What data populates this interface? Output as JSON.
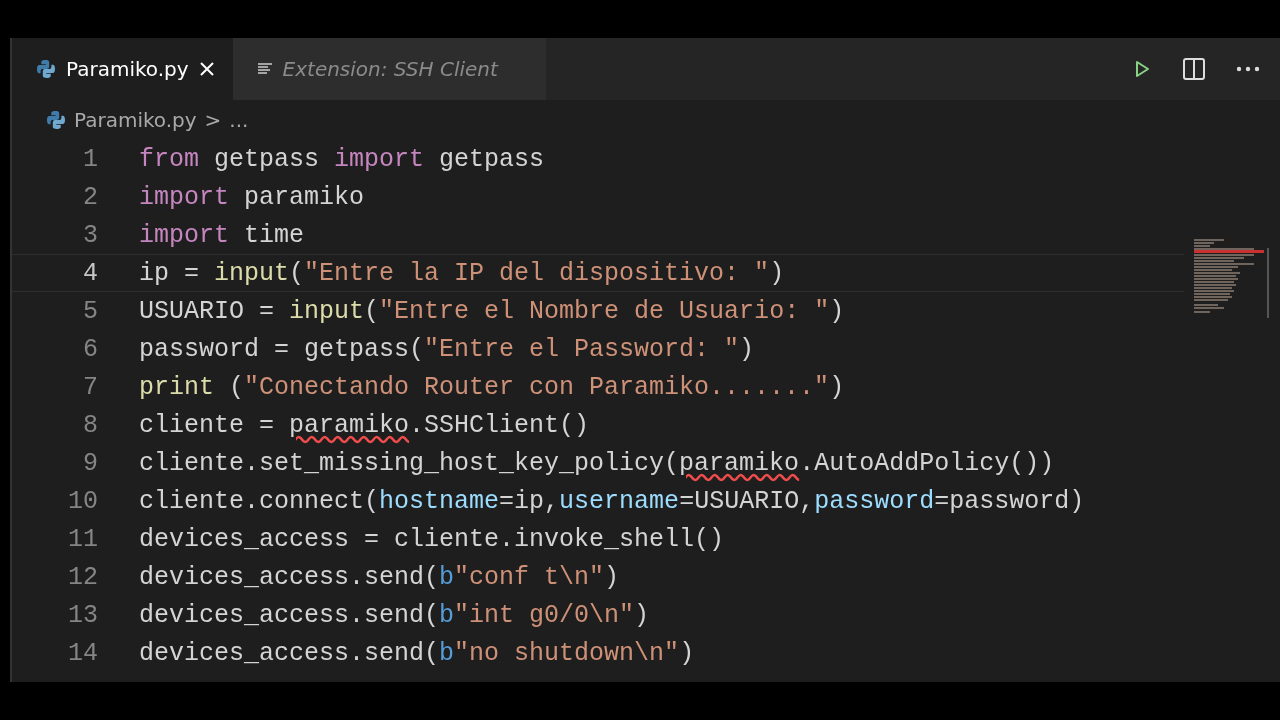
{
  "tabs": [
    {
      "label": "Paramiko.py",
      "selected": true,
      "kind": "python",
      "closable": true
    },
    {
      "label": "Extension: SSH Client",
      "selected": false,
      "kind": "preview",
      "closable": false
    }
  ],
  "breadcrumb": {
    "file": "Paramiko.py",
    "separator": ">",
    "rest": "..."
  },
  "editor": {
    "lines": [
      {
        "number": "1",
        "current": false,
        "tokens": [
          {
            "text": "from",
            "kind": "kw"
          },
          {
            "text": " getpass ",
            "kind": "plain"
          },
          {
            "text": "import",
            "kind": "kw"
          },
          {
            "text": " getpass",
            "kind": "plain"
          }
        ]
      },
      {
        "number": "2",
        "current": false,
        "tokens": [
          {
            "text": "import",
            "kind": "kw"
          },
          {
            "text": " paramiko",
            "kind": "plain"
          }
        ]
      },
      {
        "number": "3",
        "current": false,
        "tokens": [
          {
            "text": "import",
            "kind": "kw"
          },
          {
            "text": " time",
            "kind": "plain"
          }
        ]
      },
      {
        "number": "4",
        "current": true,
        "tokens": [
          {
            "text": "ip = ",
            "kind": "plain"
          },
          {
            "text": "input",
            "kind": "fn"
          },
          {
            "text": "(",
            "kind": "plain"
          },
          {
            "text": "\"Entre la IP del dispositivo: \"",
            "kind": "str"
          },
          {
            "text": ")",
            "kind": "plain"
          }
        ]
      },
      {
        "number": "5",
        "current": false,
        "tokens": [
          {
            "text": "USUARIO = ",
            "kind": "plain"
          },
          {
            "text": "input",
            "kind": "fn"
          },
          {
            "text": "(",
            "kind": "plain"
          },
          {
            "text": "\"Entre el Nombre de Usuario: \"",
            "kind": "str"
          },
          {
            "text": ")",
            "kind": "plain"
          }
        ]
      },
      {
        "number": "6",
        "current": false,
        "tokens": [
          {
            "text": "password = getpass(",
            "kind": "plain"
          },
          {
            "text": "\"Entre el Password: \"",
            "kind": "str"
          },
          {
            "text": ")",
            "kind": "plain"
          }
        ]
      },
      {
        "number": "7",
        "current": false,
        "tokens": [
          {
            "text": "print",
            "kind": "fn"
          },
          {
            "text": " (",
            "kind": "plain"
          },
          {
            "text": "\"Conectando Router con Paramiko.......\"",
            "kind": "str"
          },
          {
            "text": ")",
            "kind": "plain"
          }
        ]
      },
      {
        "number": "8",
        "current": false,
        "tokens": [
          {
            "text": "cliente = ",
            "kind": "plain"
          },
          {
            "text": "paramiko",
            "kind": "error"
          },
          {
            "text": ".SSHClient()",
            "kind": "plain"
          }
        ]
      },
      {
        "number": "9",
        "current": false,
        "tokens": [
          {
            "text": "cliente.set_missing_host_key_policy(",
            "kind": "plain"
          },
          {
            "text": "paramiko",
            "kind": "error"
          },
          {
            "text": ".AutoAddPolicy())",
            "kind": "plain"
          }
        ]
      },
      {
        "number": "10",
        "current": false,
        "tokens": [
          {
            "text": "cliente.connect(",
            "kind": "plain"
          },
          {
            "text": "hostname",
            "kind": "param"
          },
          {
            "text": "=ip,",
            "kind": "plain"
          },
          {
            "text": "username",
            "kind": "param"
          },
          {
            "text": "=USUARIO,",
            "kind": "plain"
          },
          {
            "text": "password",
            "kind": "param"
          },
          {
            "text": "=password)",
            "kind": "plain"
          }
        ]
      },
      {
        "number": "11",
        "current": false,
        "tokens": [
          {
            "text": "devices_access = cliente.invoke_shell()",
            "kind": "plain"
          }
        ]
      },
      {
        "number": "12",
        "current": false,
        "tokens": [
          {
            "text": "devices_access.send(",
            "kind": "plain"
          },
          {
            "text": "b",
            "kind": "prefix"
          },
          {
            "text": "\"conf t\\n\"",
            "kind": "str"
          },
          {
            "text": ")",
            "kind": "plain"
          }
        ]
      },
      {
        "number": "13",
        "current": false,
        "tokens": [
          {
            "text": "devices_access.send(",
            "kind": "plain"
          },
          {
            "text": "b",
            "kind": "prefix"
          },
          {
            "text": "\"int g0/0\\n\"",
            "kind": "str"
          },
          {
            "text": ")",
            "kind": "plain"
          }
        ]
      },
      {
        "number": "14",
        "current": false,
        "tokens": [
          {
            "text": "devices_access.send(",
            "kind": "plain"
          },
          {
            "text": "b",
            "kind": "prefix"
          },
          {
            "text": "\"no shutdown\\n\"",
            "kind": "str"
          },
          {
            "text": ")",
            "kind": "plain"
          }
        ]
      }
    ]
  }
}
